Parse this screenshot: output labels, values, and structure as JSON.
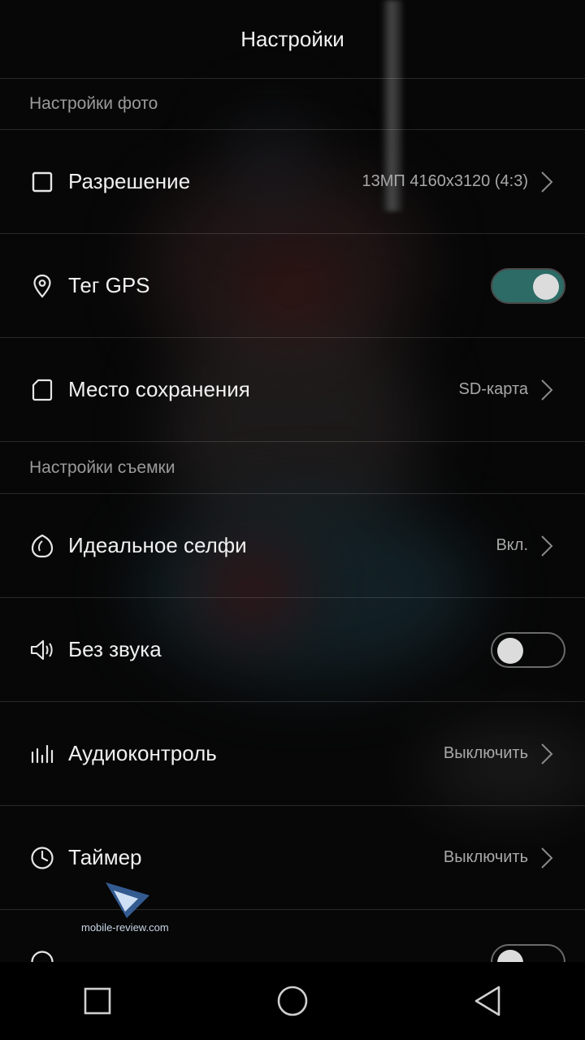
{
  "header": {
    "title": "Настройки"
  },
  "sections": [
    {
      "title": "Настройки фото",
      "items": [
        {
          "label": "Разрешение",
          "value": "13МП 4160x3120 (4:3)",
          "icon": "square-icon",
          "control": "chevron"
        },
        {
          "label": "Тег GPS",
          "icon": "location-pin-icon",
          "control": "toggle",
          "on": true
        },
        {
          "label": "Место сохранения",
          "value": "SD-карта",
          "icon": "sd-card-icon",
          "control": "chevron"
        }
      ]
    },
    {
      "title": "Настройки съемки",
      "items": [
        {
          "label": "Идеальное селфи",
          "value": "Вкл.",
          "icon": "selfie-icon",
          "control": "chevron"
        },
        {
          "label": "Без звука",
          "icon": "speaker-icon",
          "control": "toggle",
          "on": false
        },
        {
          "label": "Аудиоконтроль",
          "value": "Выключить",
          "icon": "audio-bars-icon",
          "control": "chevron"
        },
        {
          "label": "Таймер",
          "value": "Выключить",
          "icon": "clock-icon",
          "control": "chevron"
        }
      ]
    }
  ],
  "watermark": {
    "text": "mobile-review.com"
  },
  "colors": {
    "toggle_on": "#2c6b66",
    "background": "#0b0b0b",
    "text": "#f0f0f0",
    "secondary": "#a8a8a8"
  },
  "nav": [
    "recent-apps-icon",
    "home-icon",
    "back-icon"
  ]
}
